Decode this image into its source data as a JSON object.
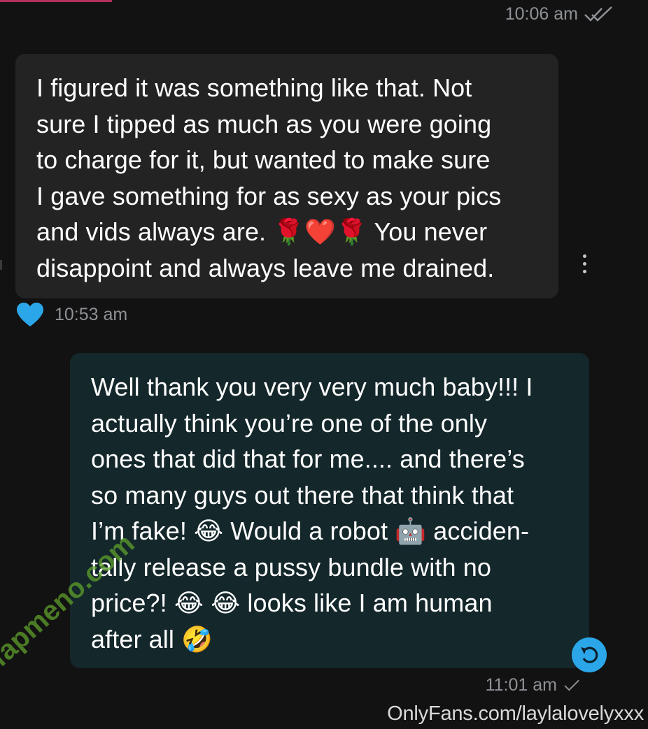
{
  "messages": {
    "top_time": "10:06 am",
    "received": {
      "text": "I figured it was something like that. Not\nsure I tipped as much as you were going\nto charge for it, but wanted to make sure\nI gave something for as sexy as your pics\nand vids always are. 🌹❤️🌹 You never\ndisappoint and always leave me drained.",
      "time": "10:53 am"
    },
    "sent": {
      "text": "Well thank you very very much baby!!! I\nactually think you’re one of the only\nones that did that for me.... and there’s\nso many guys out there that think that\nI’m fake! 😂 Would a robot 🤖 acciden-\ntally release a pussy bundle with no\nprice?! 😂 😂 looks like I am human\nafter all 🤣",
      "time": "11:01 am"
    }
  },
  "watermarks": {
    "url": "OnlyFans.com/laylalovelyxxx",
    "logo": "fapmeno.com"
  },
  "icons": {
    "read_receipt": "double-check-icon",
    "sent_receipt": "check-icon",
    "like": "heart-icon",
    "menu": "more-vertical-icon",
    "reply": "reply-icon"
  },
  "colors": {
    "background": "#121212",
    "received_bubble": "#232323",
    "sent_bubble": "#14272b",
    "heart": "#2ba7e9",
    "reply_button": "#2ba7e9",
    "timestamp": "#8e9196",
    "logo_watermark": "#5e9f2a"
  }
}
